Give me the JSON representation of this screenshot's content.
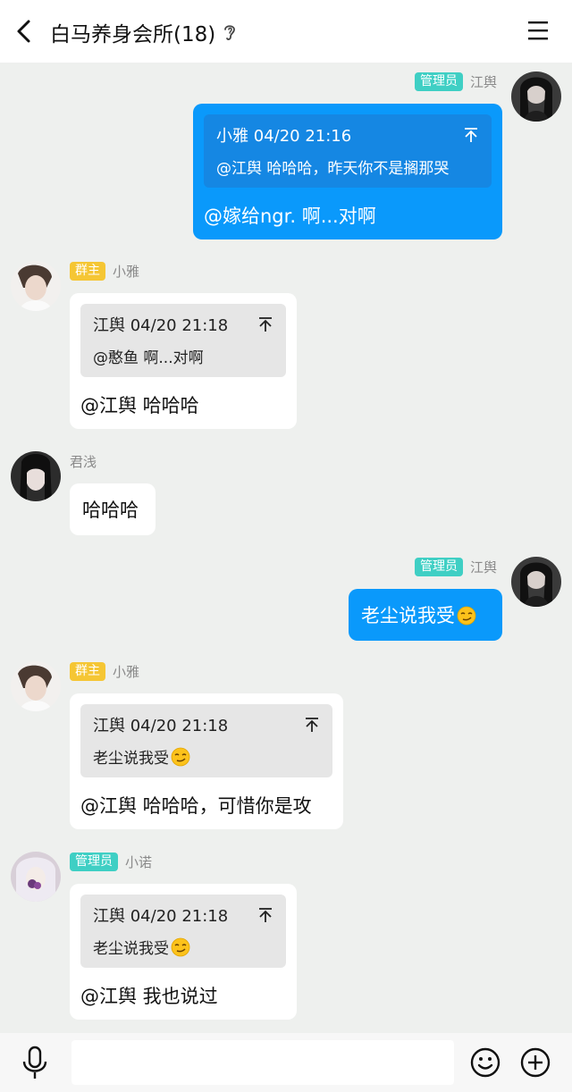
{
  "header": {
    "title": "白马养身会所(18)",
    "back_icon": "chevron-left-icon",
    "ear_icon": "ear-icon",
    "menu_icon": "hamburger-menu-icon"
  },
  "colors": {
    "blue_bubble": "#0a99fb",
    "admin_badge": "#3fcfc4",
    "owner_badge": "#f5c634",
    "background": "#eef0ee"
  },
  "messages": [
    {
      "side": "right",
      "badge": "管理员",
      "sender": "江舆",
      "quote": {
        "author_time": "小雅 04/20 21:16",
        "text": "@江舆 哈哈哈，昨天你不是搁那哭"
      },
      "text": "@嫁给ngr. 啊...对啊"
    },
    {
      "side": "left",
      "badge": "群主",
      "sender": "小雅",
      "quote": {
        "author_time": "江舆 04/20 21:18",
        "text": "@憨鱼 啊...对啊"
      },
      "text": "@江舆 哈哈哈"
    },
    {
      "side": "left",
      "sender": "君浅",
      "text": "哈哈哈"
    },
    {
      "side": "right",
      "badge": "管理员",
      "sender": "江舆",
      "text": "老尘说我受",
      "emoji": "smirk-emoji"
    },
    {
      "side": "left",
      "badge": "群主",
      "sender": "小雅",
      "quote": {
        "author_time": "江舆 04/20 21:18",
        "text": "老尘说我受"
      },
      "text": "@江舆 哈哈哈，可惜你是攻"
    },
    {
      "side": "left",
      "badge": "管理员",
      "sender": "小诺",
      "quote": {
        "author_time": "江舆 04/20 21:18",
        "text": "老尘说我受"
      },
      "text": "@江舆 我也说过"
    }
  ],
  "input_bar": {
    "placeholder": "",
    "mic_icon": "microphone-icon",
    "emoji_icon": "smiley-icon",
    "plus_icon": "plus-circle-icon"
  }
}
